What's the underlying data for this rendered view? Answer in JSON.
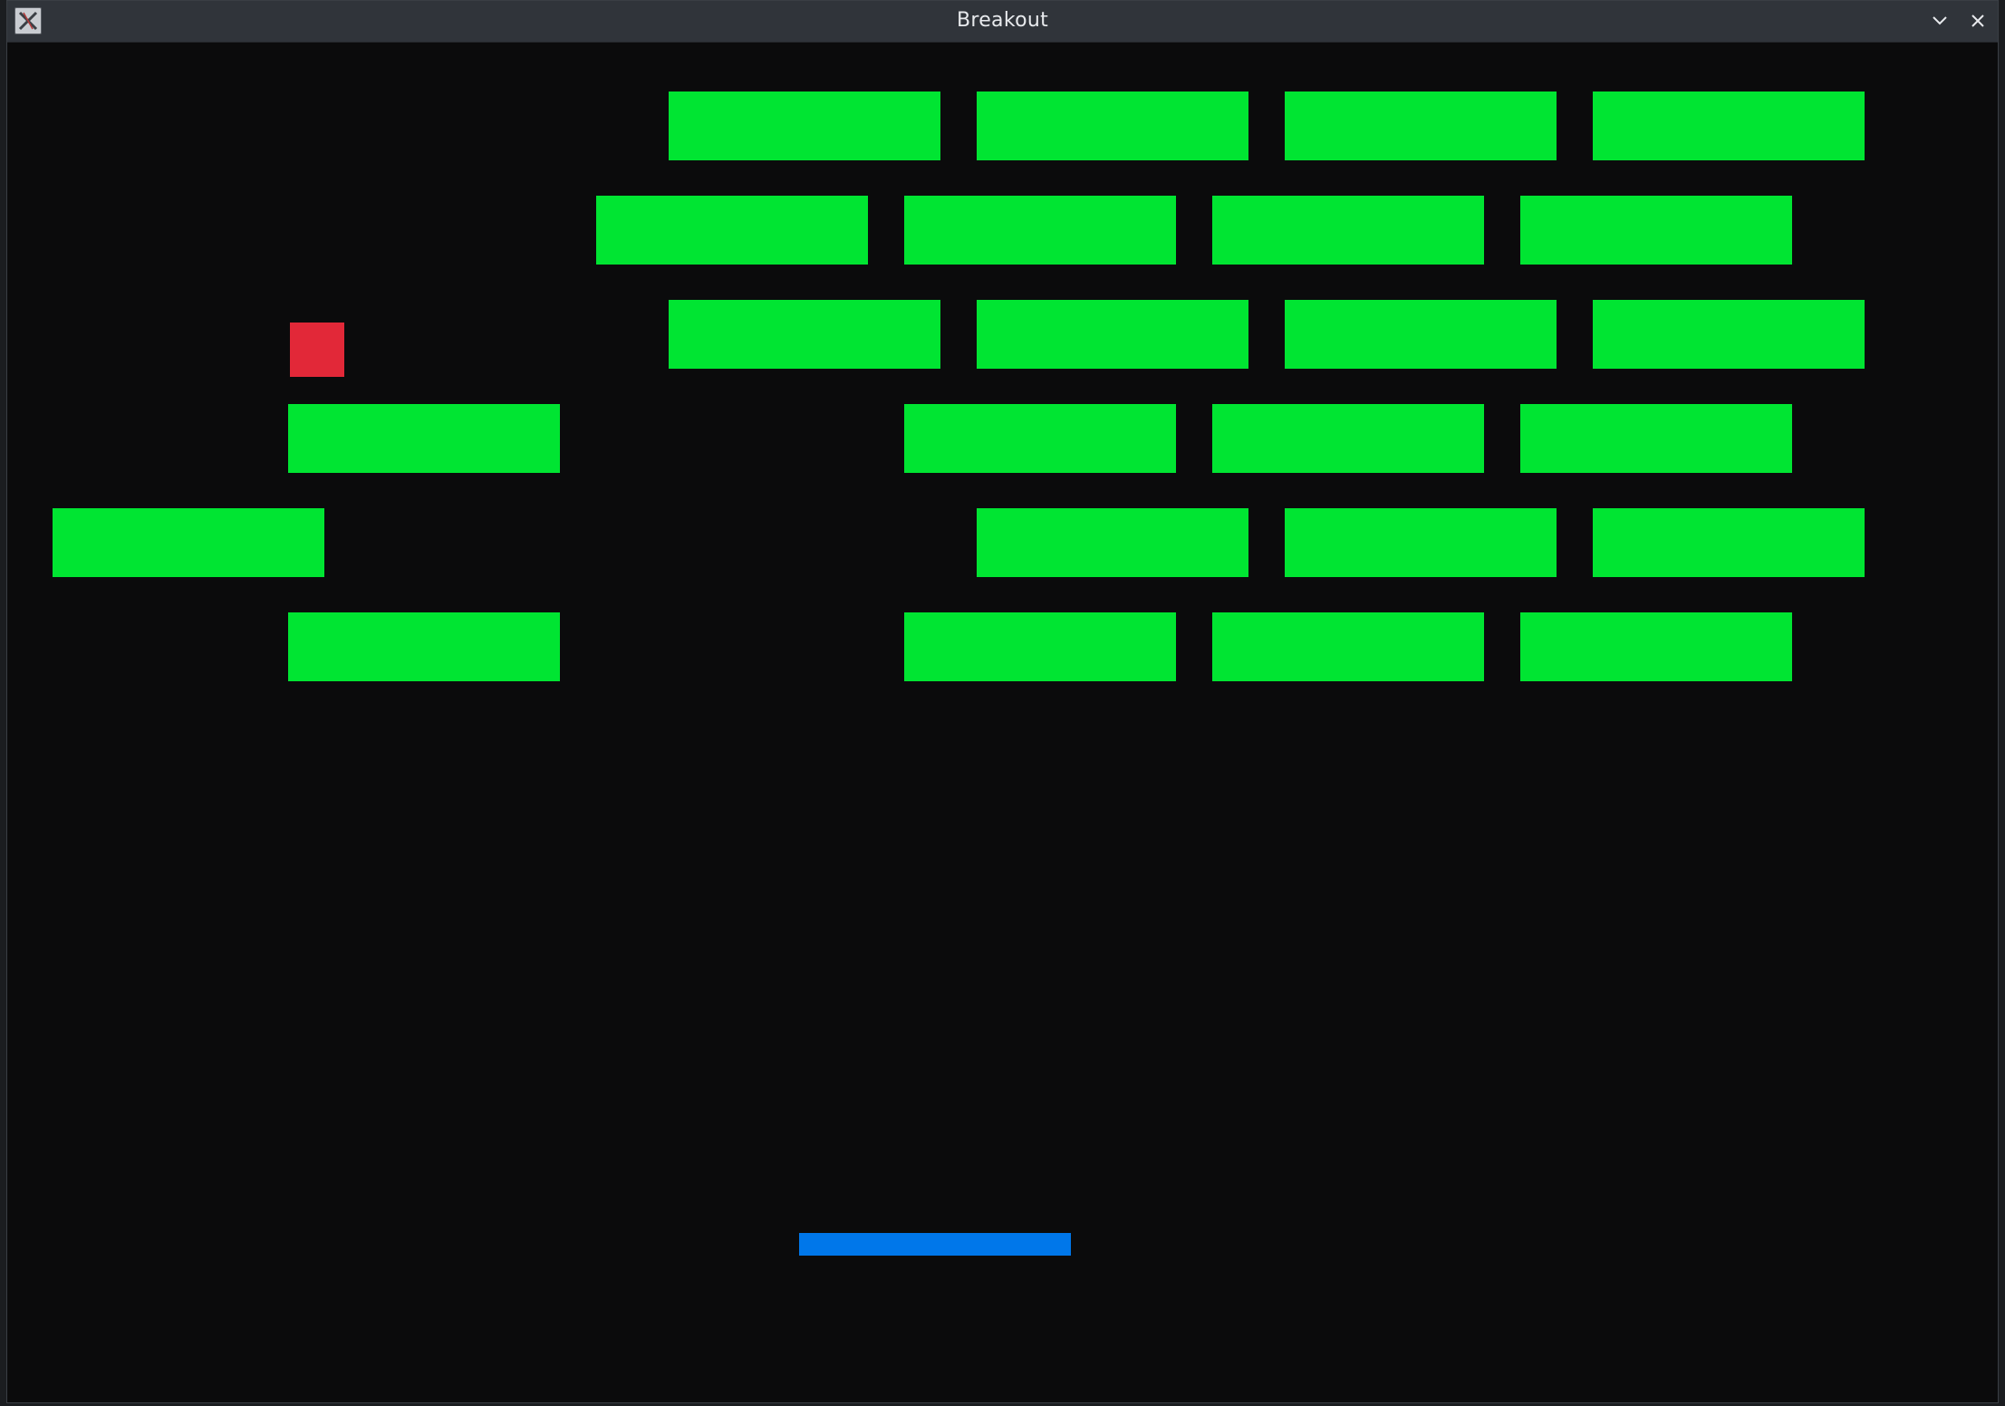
{
  "window": {
    "title": "Breakout",
    "icons": {
      "app": "x-app-icon",
      "minimize": "chevron-down-icon",
      "close": "close-icon"
    }
  },
  "game": {
    "colors": {
      "background": "#0b0b0c",
      "brick": "#00e532",
      "ball": "#e22838",
      "paddle": "#0077ea"
    },
    "brick_grid": {
      "rows": 6,
      "columns_per_row": [
        6,
        6,
        6,
        6,
        6,
        6
      ],
      "present": [
        [
          false,
          false,
          true,
          true,
          true,
          true
        ],
        [
          false,
          false,
          true,
          true,
          true,
          true
        ],
        [
          false,
          false,
          true,
          true,
          true,
          true
        ],
        [
          false,
          true,
          false,
          true,
          true,
          true
        ],
        [
          true,
          false,
          false,
          true,
          true,
          true
        ],
        [
          false,
          true,
          false,
          true,
          true,
          true
        ]
      ]
    }
  }
}
